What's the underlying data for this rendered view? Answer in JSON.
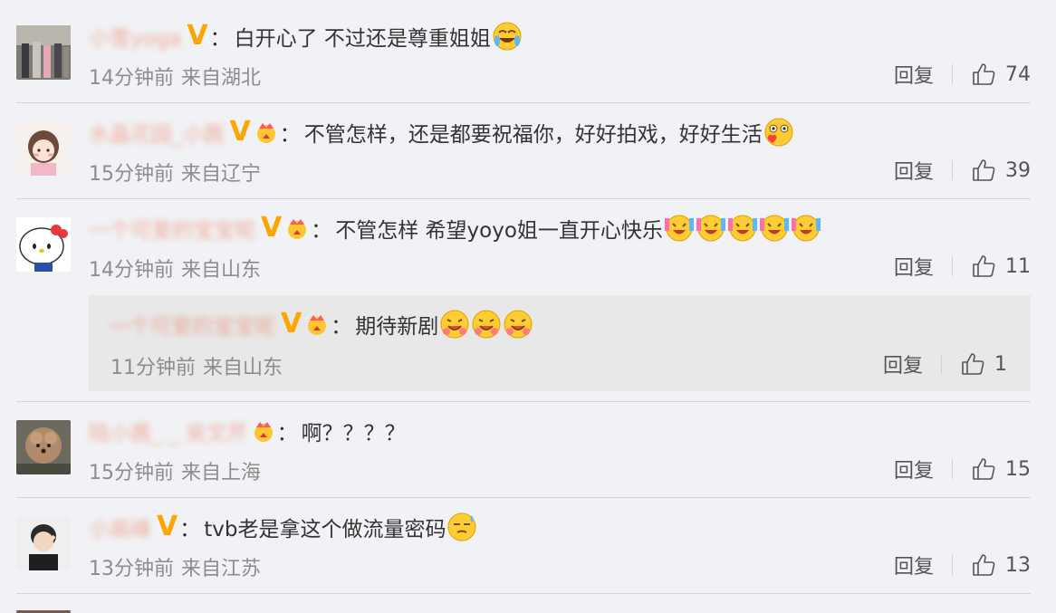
{
  "labels": {
    "reply": "回复",
    "colon": "："
  },
  "comments": [
    {
      "username": "小雪yoga",
      "text": "白开心了 不过还是尊重姐姐",
      "time": "14分钟前",
      "location": "来自湖北",
      "likes": "74"
    },
    {
      "username": "水晶花园_小茜",
      "text": "不管怎样，还是都要祝福你，好好拍戏，好好生活",
      "time": "15分钟前",
      "location": "来自辽宁",
      "likes": "39"
    },
    {
      "username": "一个可爱的宝宝呢",
      "text": "不管怎样 希望yoyo姐一直开心快乐",
      "time": "14分钟前",
      "location": "来自山东",
      "likes": "11"
    },
    {
      "username": "陆小茜_ _ 吴文芹",
      "text": "啊？？？？",
      "time": "15分钟前",
      "location": "来自上海",
      "likes": "15"
    },
    {
      "username": "小高峰",
      "text": "tvb老是拿这个做流量密码",
      "time": "13分钟前",
      "location": "来自江苏",
      "likes": "13"
    }
  ],
  "reply_item": {
    "username": "一个可爱的宝宝呢",
    "text": "期待新剧",
    "time": "11分钟前",
    "location": "来自山东",
    "likes": "1"
  },
  "colors": {
    "accent_name": "#eb7350",
    "vip": "#ffa500",
    "meta": "#8d8d8d",
    "background": "#f1f2f5"
  },
  "icons": [
    "verified-v-icon",
    "vip-crown-icon",
    "thumbs-up-icon",
    "laugh-cry-emoji",
    "heart-eyes-emoji",
    "hug-emoji",
    "sweat-emoji",
    "cheer-emoji"
  ]
}
